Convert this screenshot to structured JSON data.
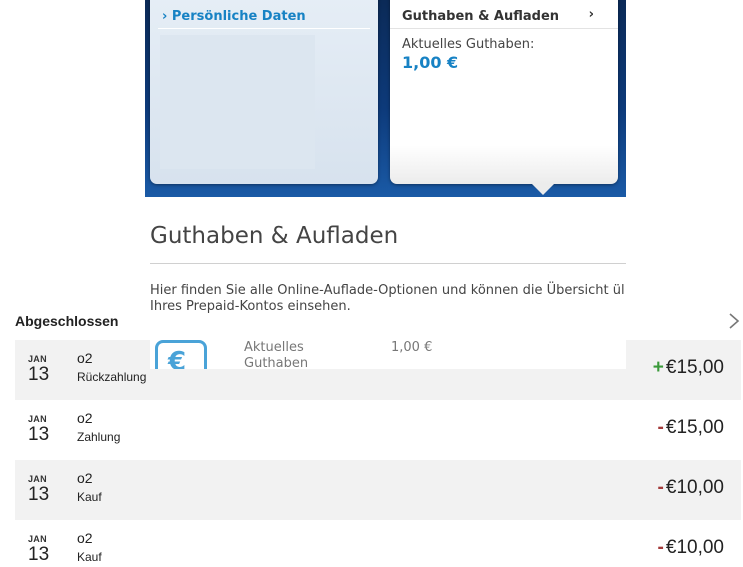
{
  "o2_page": {
    "cards": {
      "personal": {
        "title": "Persönliche Daten",
        "chevron": "›"
      },
      "credit": {
        "title": "Guthaben & Aufladen",
        "chevron": "›",
        "balance_label": "Aktuelles Guthaben:",
        "balance_value": "1,00 €"
      }
    },
    "page_title": "Guthaben & Aufladen",
    "intro_line1": "Hier finden Sie alle Online-Auflade-Optionen und können die Übersicht ül",
    "intro_line2": "Ihres Prepaid-Kontos einsehen.",
    "summary": {
      "icon": "€",
      "label_line1": "Aktuelles",
      "label_line2": "Guthaben",
      "value": "1,00 €"
    }
  },
  "transactions": {
    "section_title": "Abgeschlossen",
    "items": [
      {
        "month": "JAN",
        "day": "13",
        "merchant": "o2",
        "type": "Rückzahlung",
        "sign": "+",
        "amount": "€15,00"
      },
      {
        "month": "JAN",
        "day": "13",
        "merchant": "o2",
        "type": "Zahlung",
        "sign": "-",
        "amount": "€15,00"
      },
      {
        "month": "JAN",
        "day": "13",
        "merchant": "o2",
        "type": "Kauf",
        "sign": "-",
        "amount": "€10,00"
      },
      {
        "month": "JAN",
        "day": "13",
        "merchant": "o2",
        "type": "Kauf",
        "sign": "-",
        "amount": "€10,00"
      }
    ]
  },
  "colors": {
    "o2_blue": "#1782c4",
    "banner": "#0d3a7a",
    "positive": "#3a9a3a",
    "negative": "#a33a3a",
    "row_shade": "#f2f2f2"
  }
}
